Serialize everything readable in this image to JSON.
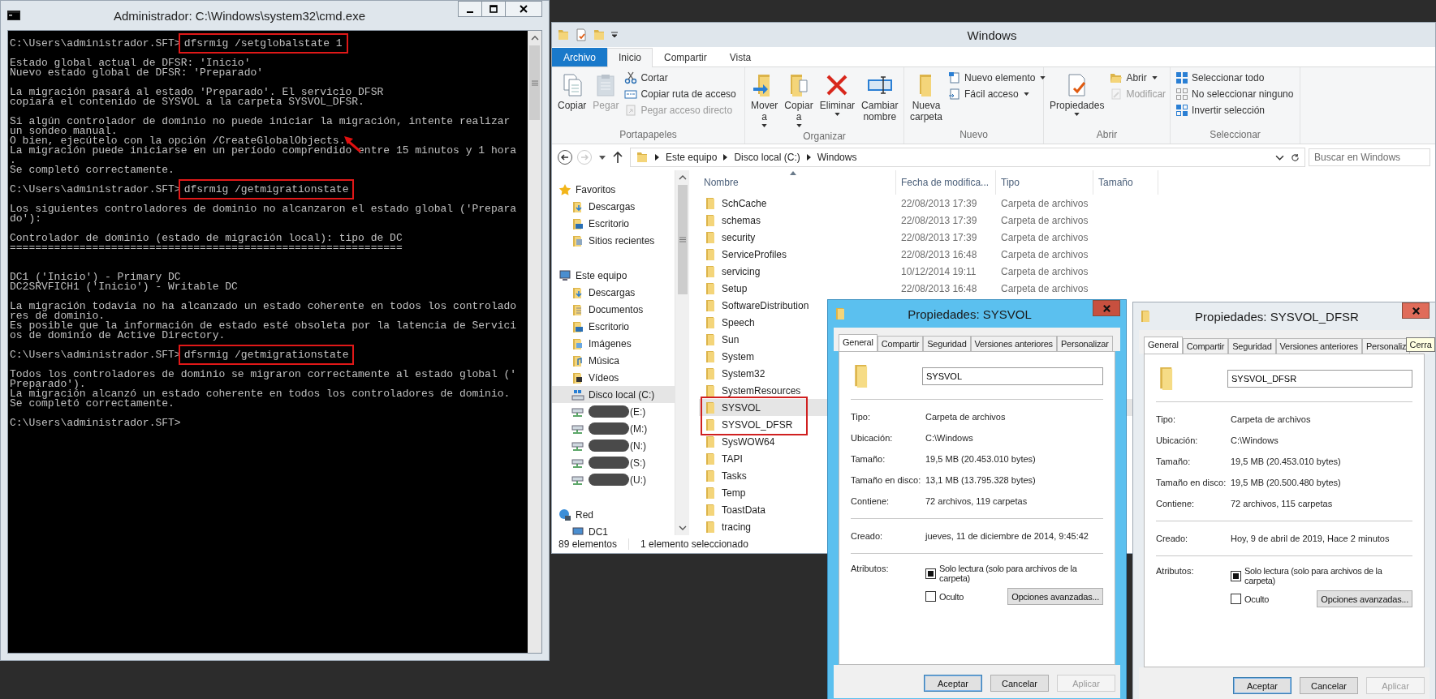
{
  "cmd_window": {
    "title": "Administrador: C:\\Windows\\system32\\cmd.exe",
    "active": false,
    "lines": [
      {
        "kind": "command",
        "prompt": "C:\\Users\\administrador.SFT>",
        "command": "dfsrmig /setglobalstate 1",
        "highlighted": true
      },
      {
        "kind": "blank"
      },
      {
        "kind": "output",
        "text": "Estado global actual de DFSR: 'Inicio'"
      },
      {
        "kind": "output",
        "text": "Nuevo estado global de DFSR: 'Preparado'"
      },
      {
        "kind": "blank"
      },
      {
        "kind": "output",
        "text": "La migración pasará al estado 'Preparado'. El servicio DFSR"
      },
      {
        "kind": "output",
        "text": "copiará el contenido de SYSVOL a la carpeta SYSVOL_DFSR."
      },
      {
        "kind": "blank"
      },
      {
        "kind": "output",
        "text": "Si algún controlador de dominio no puede iniciar la migración, intente realizar"
      },
      {
        "kind": "output",
        "text": "un sondeo manual."
      },
      {
        "kind": "output",
        "text": "O bien, ejecútelo con la opción /CreateGlobalObjects."
      },
      {
        "kind": "output",
        "text": "La migración puede iniciarse en un período comprendido entre 15 minutos y 1 hora"
      },
      {
        "kind": "output",
        "text": "."
      },
      {
        "kind": "output",
        "text": "Se completó correctamente."
      },
      {
        "kind": "blank"
      },
      {
        "kind": "command",
        "prompt": "C:\\Users\\administrador.SFT>",
        "command": "dfsrmig /getmigrationstate",
        "highlighted": true
      },
      {
        "kind": "blank"
      },
      {
        "kind": "output",
        "text": "Los siguientes controladores de dominio no alcanzaron el estado global ('Prepara"
      },
      {
        "kind": "output",
        "text": "do'):"
      },
      {
        "kind": "blank"
      },
      {
        "kind": "output",
        "text": "Controlador de dominio (estado de migración local): tipo de DC"
      },
      {
        "kind": "output",
        "text": "=============================================================="
      },
      {
        "kind": "blank"
      },
      {
        "kind": "blank"
      },
      {
        "kind": "output",
        "text": "DC1 ('Inicio') - Primary DC"
      },
      {
        "kind": "output",
        "text": "DC2SRVFICH1 ('Inicio') - Writable DC"
      },
      {
        "kind": "blank"
      },
      {
        "kind": "output",
        "text": "La migración todavía no ha alcanzado un estado coherente en todos los controlado"
      },
      {
        "kind": "output",
        "text": "res de dominio."
      },
      {
        "kind": "output",
        "text": "Es posible que la información de estado esté obsoleta por la latencia de Servici"
      },
      {
        "kind": "output",
        "text": "os de dominio de Active Directory."
      },
      {
        "kind": "blank"
      },
      {
        "kind": "command",
        "prompt": "C:\\Users\\administrador.SFT>",
        "command": "dfsrmig /getmigrationstate",
        "highlighted": true
      },
      {
        "kind": "blank"
      },
      {
        "kind": "output",
        "text": "Todos los controladores de dominio se migraron correctamente al estado global ('"
      },
      {
        "kind": "output",
        "text": "Preparado')."
      },
      {
        "kind": "output",
        "text": "La migración alcanzó un estado coherente en todos los controladores de dominio."
      },
      {
        "kind": "output",
        "text": "Se completó correctamente."
      },
      {
        "kind": "blank"
      },
      {
        "kind": "prompt",
        "prompt": "C:\\Users\\administrador.SFT>"
      }
    ]
  },
  "explorer": {
    "title": "Windows",
    "active": false,
    "ribbon_tabs": [
      {
        "label": "Archivo",
        "kind": "file",
        "selected": false
      },
      {
        "label": "Inicio",
        "kind": "tab",
        "selected": true
      },
      {
        "label": "Compartir",
        "kind": "tab",
        "selected": false
      },
      {
        "label": "Vista",
        "kind": "tab",
        "selected": false
      }
    ],
    "ribbon_groups": [
      {
        "label": "Portapapeles",
        "items": [
          {
            "kind": "large",
            "label": "Copiar",
            "disabled": false,
            "dropdown": false
          },
          {
            "kind": "large",
            "label": "Pegar",
            "disabled": true,
            "dropdown": false
          },
          {
            "kind": "small",
            "label": "Cortar",
            "disabled": false,
            "dropdown": false
          },
          {
            "kind": "small",
            "label": "Copiar ruta de acceso",
            "disabled": false,
            "dropdown": false
          },
          {
            "kind": "small",
            "label": "Pegar acceso directo",
            "disabled": true,
            "dropdown": false
          }
        ]
      },
      {
        "label": "Organizar",
        "items": [
          {
            "kind": "large",
            "label": "Mover a",
            "disabled": false,
            "dropdown": true
          },
          {
            "kind": "large",
            "label": "Copiar a",
            "disabled": false,
            "dropdown": true
          },
          {
            "kind": "large",
            "label": "Eliminar",
            "disabled": false,
            "dropdown": true
          },
          {
            "kind": "large",
            "label": "Cambiar nombre",
            "disabled": false,
            "dropdown": false
          }
        ]
      },
      {
        "label": "Nuevo",
        "items": [
          {
            "kind": "large",
            "label": "Nueva carpeta",
            "disabled": false,
            "dropdown": false
          },
          {
            "kind": "small",
            "label": "Nuevo elemento",
            "disabled": false,
            "dropdown": true
          },
          {
            "kind": "small",
            "label": "Fácil acceso",
            "disabled": false,
            "dropdown": true
          }
        ]
      },
      {
        "label": "Abrir",
        "items": [
          {
            "kind": "large",
            "label": "Propiedades",
            "disabled": false,
            "dropdown": true
          },
          {
            "kind": "small",
            "label": "Abrir",
            "disabled": false,
            "dropdown": true
          },
          {
            "kind": "small",
            "label": "Modificar",
            "disabled": true,
            "dropdown": false
          }
        ]
      },
      {
        "label": "Seleccionar",
        "items": [
          {
            "kind": "small",
            "label": "Seleccionar todo",
            "disabled": false,
            "dropdown": false
          },
          {
            "kind": "small",
            "label": "No seleccionar ninguno",
            "disabled": false,
            "dropdown": false
          },
          {
            "kind": "small",
            "label": "Invertir selección",
            "disabled": false,
            "dropdown": false
          }
        ]
      }
    ],
    "breadcrumbs": [
      "Este equipo",
      "Disco local (C:)",
      "Windows"
    ],
    "search": {
      "placeholder": "Buscar en Windows"
    },
    "nav": [
      {
        "label": "Favoritos",
        "kind": "favorites",
        "selected": false,
        "redacted": false,
        "children": [
          {
            "label": "Descargas",
            "kind": "downloads",
            "selected": false,
            "redacted": false
          },
          {
            "label": "Escritorio",
            "kind": "desktop",
            "selected": false,
            "redacted": false
          },
          {
            "label": "Sitios recientes",
            "kind": "recent",
            "selected": false,
            "redacted": false
          }
        ]
      },
      {
        "label": "Este equipo",
        "kind": "computer",
        "selected": false,
        "redacted": false,
        "children": [
          {
            "label": "Descargas",
            "kind": "downloads",
            "selected": false,
            "redacted": false
          },
          {
            "label": "Documentos",
            "kind": "documents",
            "selected": false,
            "redacted": false
          },
          {
            "label": "Escritorio",
            "kind": "desktop",
            "selected": false,
            "redacted": false
          },
          {
            "label": "Imágenes",
            "kind": "pictures",
            "selected": false,
            "redacted": false
          },
          {
            "label": "Música",
            "kind": "music",
            "selected": false,
            "redacted": false
          },
          {
            "label": "Vídeos",
            "kind": "videos",
            "selected": false,
            "redacted": false
          },
          {
            "label": "Disco local (C:)",
            "kind": "drive",
            "selected": true,
            "redacted": false
          },
          {
            "label": "(E:)",
            "kind": "network_drive",
            "selected": false,
            "redacted": true
          },
          {
            "label": "(M:)",
            "kind": "network_drive",
            "selected": false,
            "redacted": true
          },
          {
            "label": "(N:)",
            "kind": "network_drive",
            "selected": false,
            "redacted": true
          },
          {
            "label": "(S:)",
            "kind": "network_drive",
            "selected": false,
            "redacted": true
          },
          {
            "label": "(U:)",
            "kind": "network_drive",
            "selected": false,
            "redacted": true
          }
        ]
      },
      {
        "label": "Red",
        "kind": "network",
        "selected": false,
        "redacted": false,
        "children": [
          {
            "label": "DC1",
            "kind": "computer",
            "selected": false,
            "redacted": false
          }
        ]
      }
    ],
    "columns": [
      "Nombre",
      "Fecha de modifica...",
      "Tipo",
      "Tamaño"
    ],
    "rows": [
      {
        "name": "SchCache",
        "date": "22/08/2013 17:39",
        "type": "Carpeta de archivos",
        "selected": false,
        "highlighted": false
      },
      {
        "name": "schemas",
        "date": "22/08/2013 17:39",
        "type": "Carpeta de archivos",
        "selected": false,
        "highlighted": false
      },
      {
        "name": "security",
        "date": "22/08/2013 17:39",
        "type": "Carpeta de archivos",
        "selected": false,
        "highlighted": false
      },
      {
        "name": "ServiceProfiles",
        "date": "22/08/2013 16:48",
        "type": "Carpeta de archivos",
        "selected": false,
        "highlighted": false
      },
      {
        "name": "servicing",
        "date": "10/12/2014 19:11",
        "type": "Carpeta de archivos",
        "selected": false,
        "highlighted": false
      },
      {
        "name": "Setup",
        "date": "22/08/2013 16:48",
        "type": "Carpeta de archivos",
        "selected": false,
        "highlighted": false
      },
      {
        "name": "SoftwareDistribution",
        "selected": false,
        "highlighted": false
      },
      {
        "name": "Speech",
        "selected": false,
        "highlighted": false
      },
      {
        "name": "Sun",
        "selected": false,
        "highlighted": false
      },
      {
        "name": "System",
        "selected": false,
        "highlighted": false
      },
      {
        "name": "System32",
        "selected": false,
        "highlighted": false
      },
      {
        "name": "SystemResources",
        "selected": false,
        "highlighted": false
      },
      {
        "name": "SYSVOL",
        "selected": true,
        "highlighted": true
      },
      {
        "name": "SYSVOL_DFSR",
        "selected": false,
        "highlighted": true
      },
      {
        "name": "SysWOW64",
        "selected": false,
        "highlighted": false
      },
      {
        "name": "TAPI",
        "selected": false,
        "highlighted": false
      },
      {
        "name": "Tasks",
        "selected": false,
        "highlighted": false
      },
      {
        "name": "Temp",
        "selected": false,
        "highlighted": false
      },
      {
        "name": "ToastData",
        "selected": false,
        "highlighted": false
      },
      {
        "name": "tracing",
        "selected": false,
        "highlighted": false
      }
    ],
    "status": [
      "89 elementos",
      "1 elemento seleccionado"
    ]
  },
  "dialogs": [
    {
      "title": "Propiedades: SYSVOL",
      "active": true,
      "tabs": [
        {
          "label": "General",
          "selected": true
        },
        {
          "label": "Compartir",
          "selected": false
        },
        {
          "label": "Seguridad",
          "selected": false
        },
        {
          "label": "Versiones anteriores",
          "selected": false
        },
        {
          "label": "Personalizar",
          "selected": false
        }
      ],
      "name_value": "SYSVOL",
      "field_groups": [
        [
          {
            "label": "Tipo:",
            "value": "Carpeta de archivos"
          },
          {
            "label": "Ubicación:",
            "value": "C:\\Windows"
          },
          {
            "label": "Tamaño:",
            "value": "19,5 MB (20.453.010 bytes)"
          },
          {
            "label": "Tamaño en disco:",
            "value": "13,1 MB (13.795.328 bytes)"
          },
          {
            "label": "Contiene:",
            "value": "72 archivos, 119 carpetas"
          }
        ],
        [
          {
            "label": "Creado:",
            "value": "jueves, 11 de diciembre de 2014, 9:45:42"
          }
        ]
      ],
      "attributes_label": "Atributos:",
      "checkboxes": [
        {
          "label": "Solo lectura (solo para archivos de la carpeta)",
          "checked": false,
          "indeterminate": true
        },
        {
          "label": "Oculto",
          "checked": false,
          "indeterminate": false
        }
      ],
      "advanced_button": "Opciones avanzadas...",
      "buttons": [
        {
          "label": "Aceptar",
          "default": true,
          "disabled": false
        },
        {
          "label": "Cancelar",
          "default": false,
          "disabled": false
        },
        {
          "label": "Aplicar",
          "default": false,
          "disabled": true
        }
      ]
    },
    {
      "title": "Propiedades: SYSVOL_DFSR",
      "active": false,
      "tabs": [
        {
          "label": "General",
          "selected": true
        },
        {
          "label": "Compartir",
          "selected": false
        },
        {
          "label": "Seguridad",
          "selected": false
        },
        {
          "label": "Versiones anteriores",
          "selected": false
        },
        {
          "label": "Personaliz",
          "selected": false
        }
      ],
      "tooltip": "Cerra",
      "name_value": "SYSVOL_DFSR",
      "field_groups": [
        [
          {
            "label": "Tipo:",
            "value": "Carpeta de archivos"
          },
          {
            "label": "Ubicación:",
            "value": "C:\\Windows"
          },
          {
            "label": "Tamaño:",
            "value": "19,5 MB (20.453.010 bytes)"
          },
          {
            "label": "Tamaño en disco:",
            "value": "19,5 MB (20.500.480 bytes)"
          },
          {
            "label": "Contiene:",
            "value": "72 archivos, 115 carpetas"
          }
        ],
        [
          {
            "label": "Creado:",
            "value": "Hoy, 9 de abril de 2019, Hace 2 minutos"
          }
        ]
      ],
      "attributes_label": "Atributos:",
      "checkboxes": [
        {
          "label": "Solo lectura (solo para archivos de la carpeta)",
          "checked": false,
          "indeterminate": true
        },
        {
          "label": "Oculto",
          "checked": false,
          "indeterminate": false
        }
      ],
      "advanced_button": "Opciones avanzadas...",
      "buttons": [
        {
          "label": "Aceptar",
          "default": true,
          "disabled": false
        },
        {
          "label": "Cancelar",
          "default": false,
          "disabled": false
        },
        {
          "label": "Aplicar",
          "default": false,
          "disabled": true
        }
      ]
    }
  ]
}
